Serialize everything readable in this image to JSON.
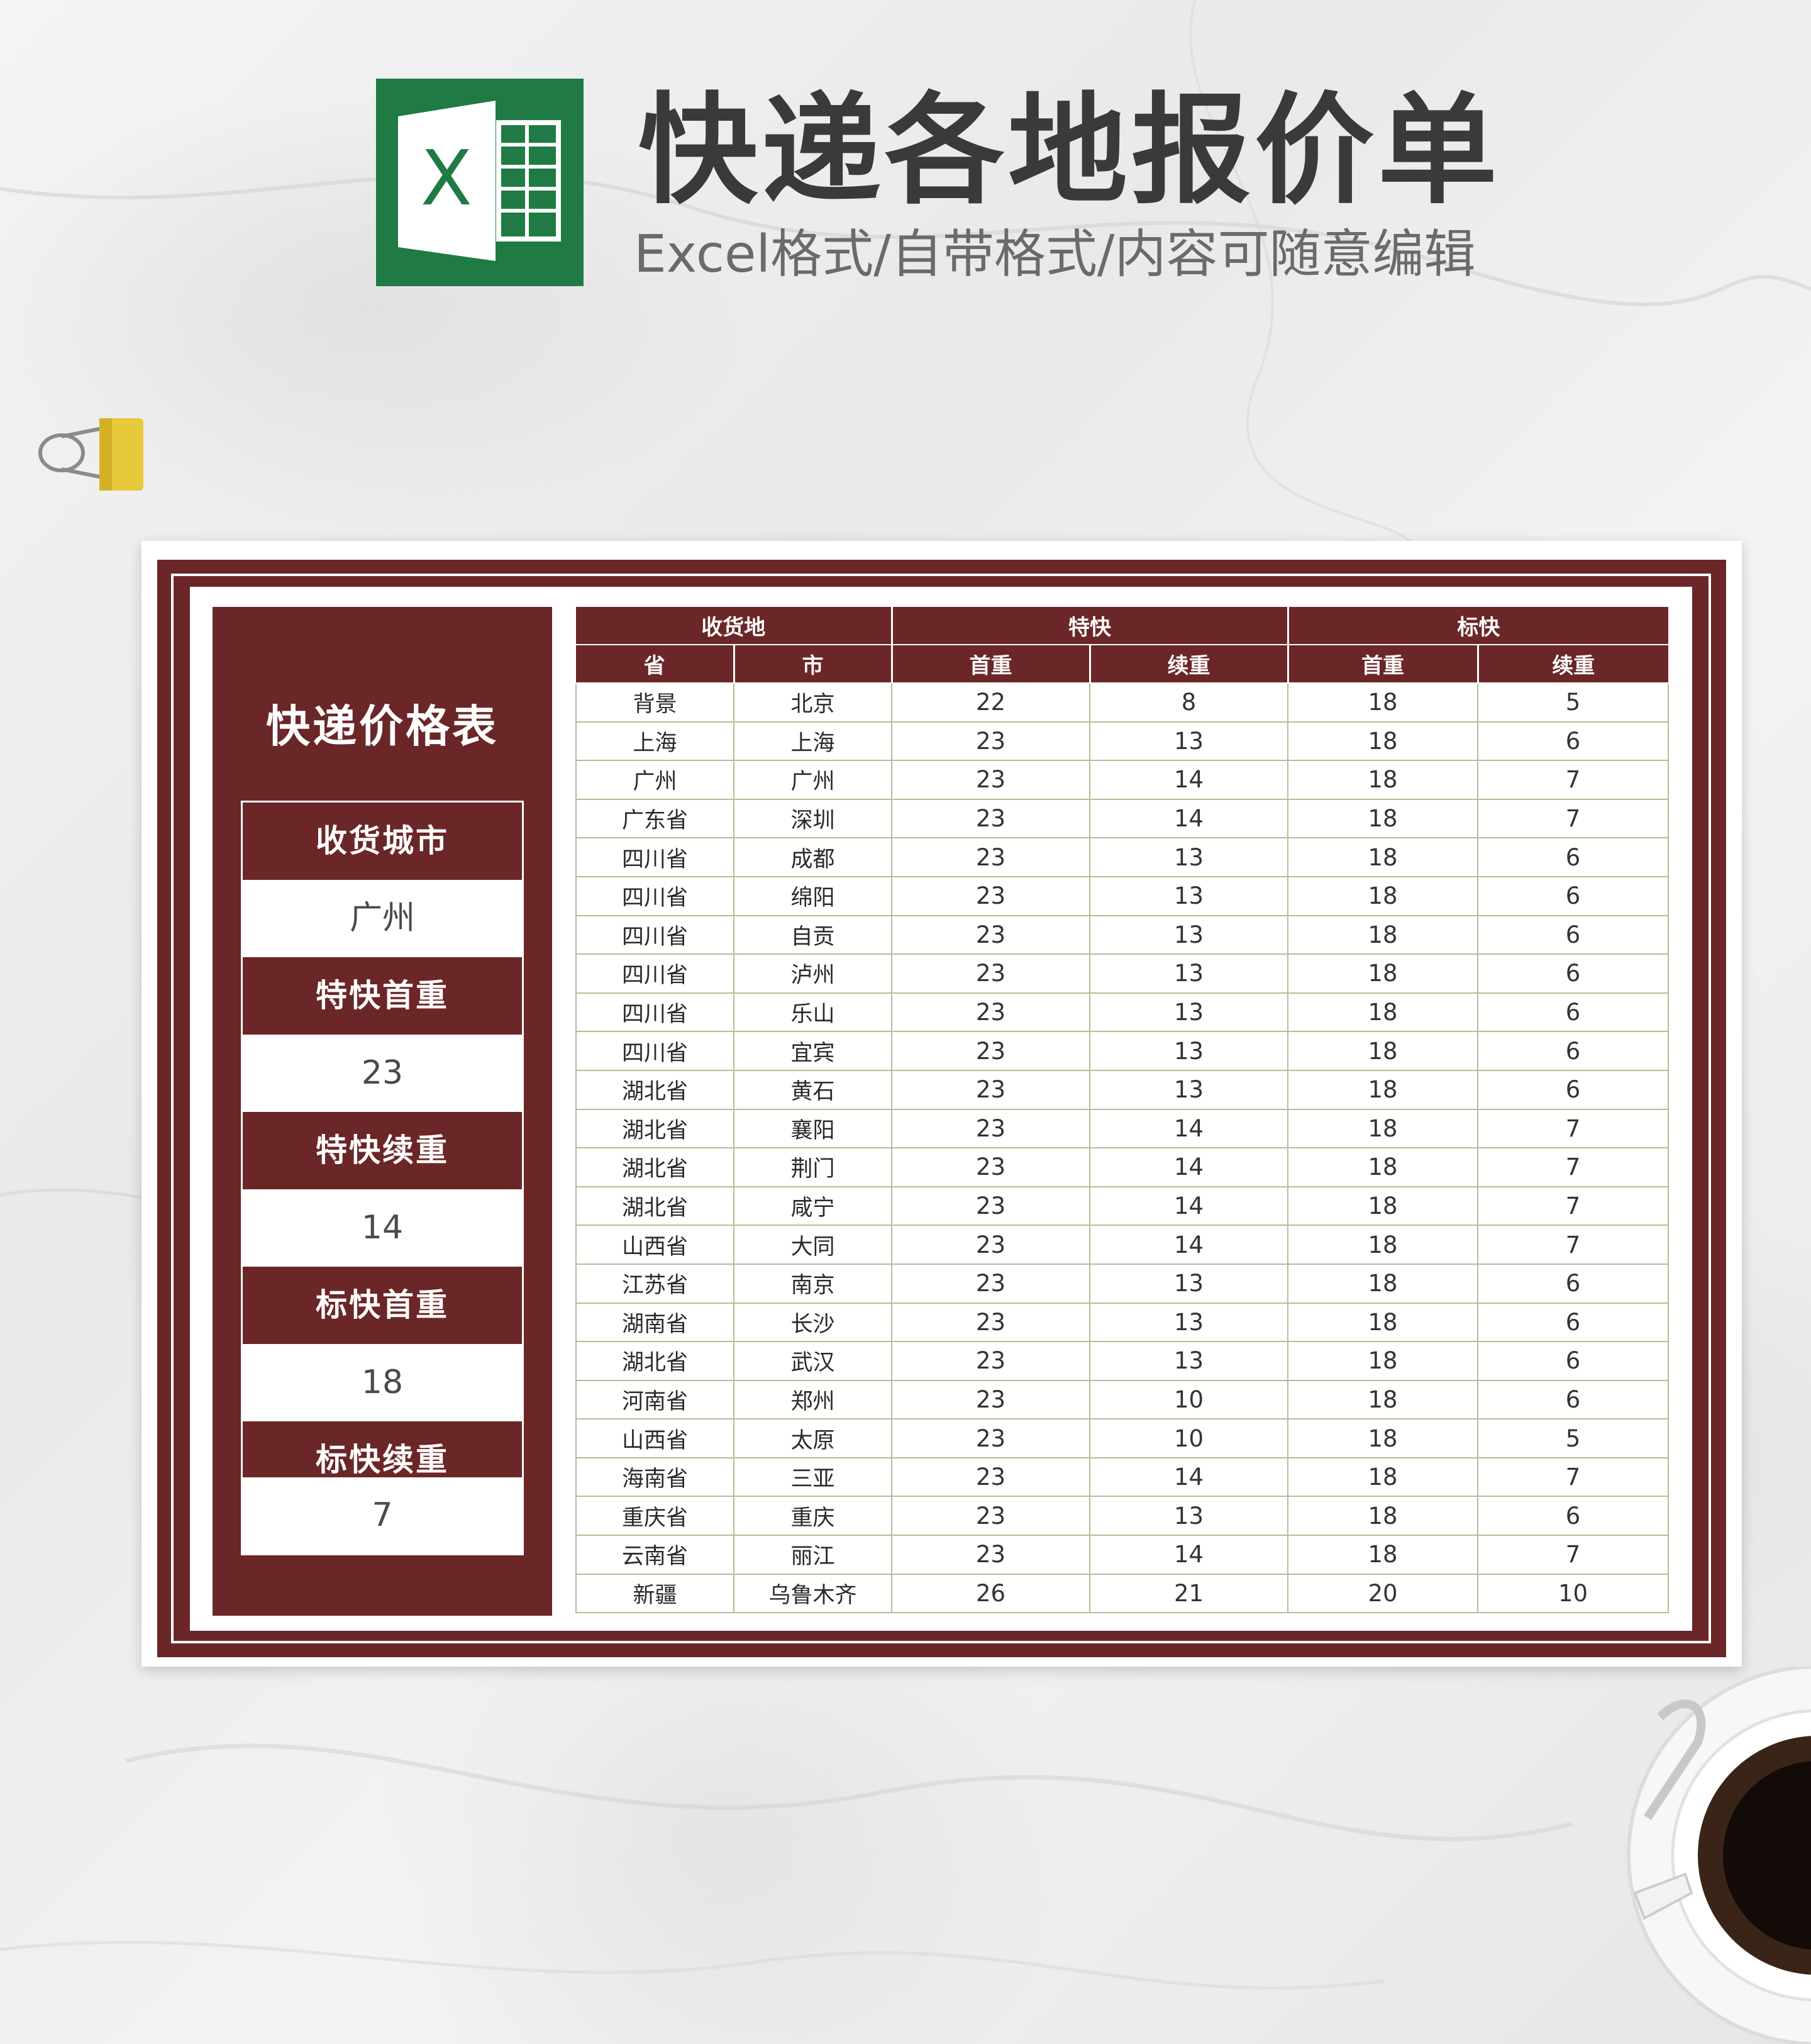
{
  "header": {
    "title": "快递各地报价单",
    "subtitle": "Excel格式/自带格式/内容可随意编辑",
    "logo_letter": "X"
  },
  "colors": {
    "accent": "#6b2627",
    "excel_green": "#1f7a44",
    "grid_line": "#b8bb98"
  },
  "panel": {
    "title": "快递价格表",
    "items": [
      {
        "label": "收货城市",
        "value": "广州"
      },
      {
        "label": "特快首重",
        "value": "23"
      },
      {
        "label": "特快续重",
        "value": "14"
      },
      {
        "label": "标快首重",
        "value": "18"
      },
      {
        "label": "标快续重",
        "value": "7"
      }
    ]
  },
  "table": {
    "groups": [
      "收货地",
      "特快",
      "标快"
    ],
    "columns": [
      "省",
      "市",
      "首重",
      "续重",
      "首重",
      "续重"
    ],
    "rows": [
      [
        "背景",
        "北京",
        "22",
        "8",
        "18",
        "5"
      ],
      [
        "上海",
        "上海",
        "23",
        "13",
        "18",
        "6"
      ],
      [
        "广州",
        "广州",
        "23",
        "14",
        "18",
        "7"
      ],
      [
        "广东省",
        "深圳",
        "23",
        "14",
        "18",
        "7"
      ],
      [
        "四川省",
        "成都",
        "23",
        "13",
        "18",
        "6"
      ],
      [
        "四川省",
        "绵阳",
        "23",
        "13",
        "18",
        "6"
      ],
      [
        "四川省",
        "自贡",
        "23",
        "13",
        "18",
        "6"
      ],
      [
        "四川省",
        "泸州",
        "23",
        "13",
        "18",
        "6"
      ],
      [
        "四川省",
        "乐山",
        "23",
        "13",
        "18",
        "6"
      ],
      [
        "四川省",
        "宜宾",
        "23",
        "13",
        "18",
        "6"
      ],
      [
        "湖北省",
        "黄石",
        "23",
        "13",
        "18",
        "6"
      ],
      [
        "湖北省",
        "襄阳",
        "23",
        "14",
        "18",
        "7"
      ],
      [
        "湖北省",
        "荆门",
        "23",
        "14",
        "18",
        "7"
      ],
      [
        "湖北省",
        "咸宁",
        "23",
        "14",
        "18",
        "7"
      ],
      [
        "山西省",
        "大同",
        "23",
        "14",
        "18",
        "7"
      ],
      [
        "江苏省",
        "南京",
        "23",
        "13",
        "18",
        "6"
      ],
      [
        "湖南省",
        "长沙",
        "23",
        "13",
        "18",
        "6"
      ],
      [
        "湖北省",
        "武汉",
        "23",
        "13",
        "18",
        "6"
      ],
      [
        "河南省",
        "郑州",
        "23",
        "10",
        "18",
        "6"
      ],
      [
        "山西省",
        "太原",
        "23",
        "10",
        "18",
        "5"
      ],
      [
        "海南省",
        "三亚",
        "23",
        "14",
        "18",
        "7"
      ],
      [
        "重庆省",
        "重庆",
        "23",
        "13",
        "18",
        "6"
      ],
      [
        "云南省",
        "丽江",
        "23",
        "14",
        "18",
        "7"
      ],
      [
        "新疆",
        "乌鲁木齐",
        "26",
        "21",
        "20",
        "10"
      ]
    ]
  }
}
